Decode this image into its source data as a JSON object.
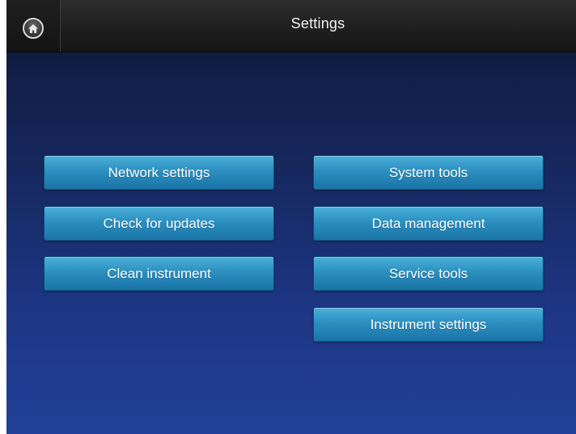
{
  "header": {
    "title": "Settings",
    "home_icon": "home-icon"
  },
  "left_column": {
    "buttons": [
      {
        "label": "Network settings"
      },
      {
        "label": "Check for updates"
      },
      {
        "label": "Clean instrument"
      }
    ]
  },
  "right_column": {
    "buttons": [
      {
        "label": "System tools"
      },
      {
        "label": "Data management"
      },
      {
        "label": "Service tools"
      },
      {
        "label": "Instrument settings"
      }
    ]
  },
  "colors": {
    "background_top": "#0d1733",
    "background_bottom": "#22409a",
    "button_accent": "#2c8fc0",
    "header_bar": "#1e1e1e",
    "text": "#ffffff"
  }
}
